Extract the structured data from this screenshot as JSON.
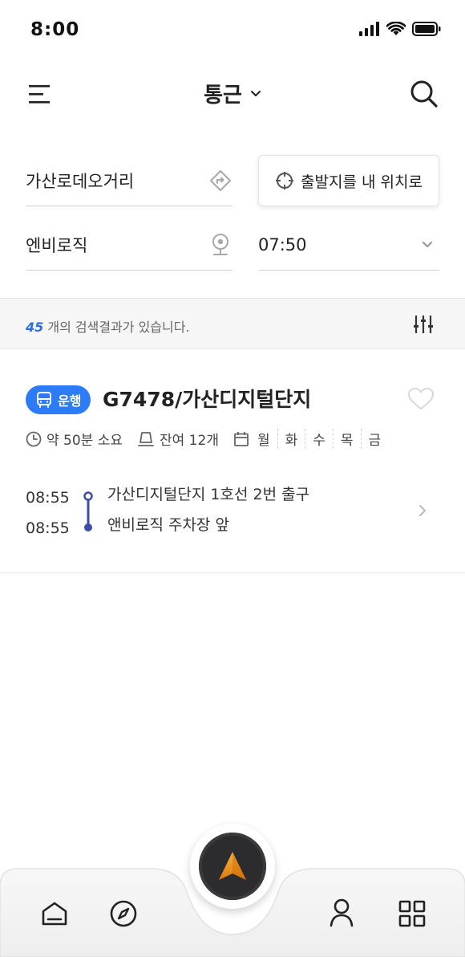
{
  "status_bar": {
    "time": "8:00"
  },
  "header": {
    "title": "통근"
  },
  "search": {
    "origin": "가산로데오거리",
    "destination": "엔비로직",
    "my_location_label": "출발지를 내 위치로",
    "time": "07:50"
  },
  "results": {
    "count": "45",
    "count_suffix": "개의 검색결과가 있습니다."
  },
  "route": {
    "badge": "운행",
    "name": "G7478/가산디지털단지",
    "duration": "약 50분 소요",
    "seats": "잔여 12개",
    "days": [
      "월",
      "화",
      "수",
      "목",
      "금"
    ],
    "stops": [
      {
        "time": "08:55",
        "name": "가산디지털단지 1호선 2번 출구"
      },
      {
        "time": "08:55",
        "name": "앤비로직 주차장 앞"
      }
    ]
  },
  "colors": {
    "accent": "#2b7cf6",
    "timeline": "#3b4fa8",
    "count": "#2b6fe0",
    "nav_arrow": "#f39a1e"
  },
  "icons": [
    "menu-icon",
    "chevron-down-icon",
    "search-icon",
    "swap-icon",
    "location-pin-icon",
    "crosshair-icon",
    "filter-icon",
    "bus-icon",
    "heart-icon",
    "clock-icon",
    "seat-icon",
    "calendar-icon",
    "chevron-right-icon",
    "home-icon",
    "compass-icon",
    "navigation-arrow-icon",
    "user-icon",
    "grid-icon"
  ]
}
